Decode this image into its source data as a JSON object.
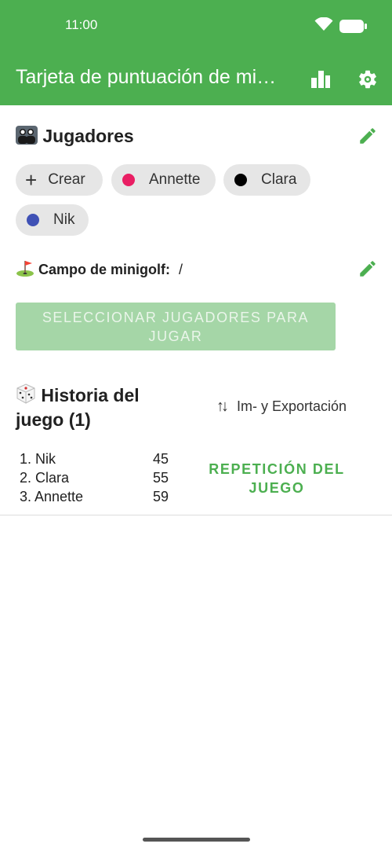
{
  "status_bar": {
    "time": "11:00",
    "icons": [
      "wifi-icon",
      "battery-icon"
    ]
  },
  "app_bar": {
    "title": "Tarjeta de puntuación de mi…",
    "actions": [
      "bar-chart-icon",
      "gear-icon"
    ]
  },
  "players_section": {
    "icon": "people-emoji",
    "title": "Jugadores",
    "edit_icon": "pencil-icon",
    "create_label": "Crear",
    "players": [
      {
        "name": "Annette",
        "color": "#E91E63"
      },
      {
        "name": "Clara",
        "color": "#000000"
      },
      {
        "name": "Nik",
        "color": "#3F51B5"
      }
    ]
  },
  "course_section": {
    "icon": "golf-flag-emoji",
    "label": "Campo de minigolf:",
    "value": "/",
    "edit_icon": "pencil-icon"
  },
  "select_button": {
    "label": "SELECCIONAR JUGADORES PARA JUGAR"
  },
  "history_section": {
    "icon": "dice-emoji",
    "title": "Historia del juego (1)",
    "export_label": "Im- y Exportación",
    "results": [
      {
        "rank": "1. Nik",
        "score": "45"
      },
      {
        "rank": "2. Clara",
        "score": "55"
      },
      {
        "rank": "3. Annette",
        "score": "59"
      }
    ],
    "replay_label": "REPETICIÓN DEL JUEGO"
  },
  "colors": {
    "primary": "#4CAF50",
    "disabled_button": "#A5D6A7",
    "chip_background": "#E6E6E6"
  }
}
